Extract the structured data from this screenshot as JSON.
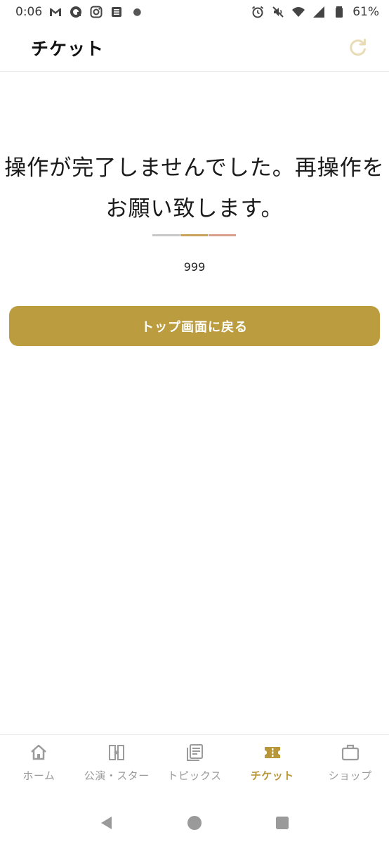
{
  "status_bar": {
    "time": "0:06",
    "battery": "61%",
    "left_icons": [
      "gmail-icon",
      "at-icon",
      "instagram-icon",
      "news-icon"
    ],
    "right_icons": [
      "alarm-icon",
      "mute-icon",
      "wifi-icon",
      "signal-icon",
      "battery-icon"
    ]
  },
  "header": {
    "title": "チケット",
    "refresh_icon": "refresh-icon"
  },
  "main": {
    "message_line1": "操作が完了しませんでした。再操作を",
    "message_line2": "お願い致します。",
    "error_code": "999",
    "button_label": "トップ画面に戻る"
  },
  "colors": {
    "accent": "#bb9d3f",
    "accent_active": "#b8963a",
    "divider": [
      "#c8c8c8",
      "#c9a35a",
      "#d8a08c"
    ],
    "nav_inactive": "#9b9b9b",
    "refresh": "#e8dbb5"
  },
  "bottom_nav": {
    "items": [
      {
        "label": "ホーム",
        "icon": "home-icon",
        "active": false
      },
      {
        "label": "公演・スター",
        "icon": "performance-icon",
        "active": false
      },
      {
        "label": "トピックス",
        "icon": "topics-icon",
        "active": false
      },
      {
        "label": "チケット",
        "icon": "ticket-icon",
        "active": true
      },
      {
        "label": "ショップ",
        "icon": "shop-icon",
        "active": false
      }
    ]
  },
  "system_nav": [
    "back-icon",
    "home-circle-icon",
    "recents-icon"
  ]
}
